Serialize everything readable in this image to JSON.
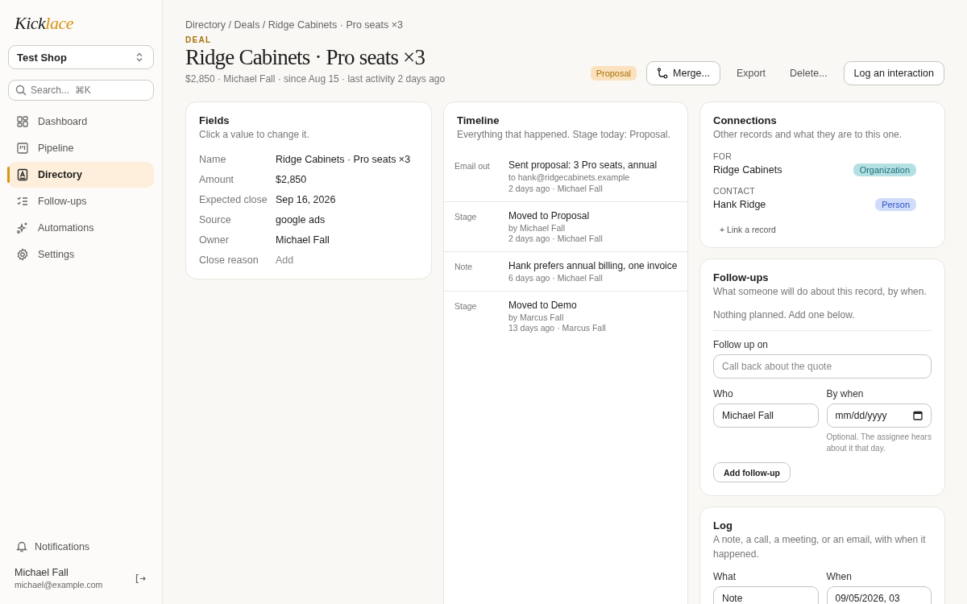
{
  "sidebar": {
    "logo": {
      "text": "Kick",
      "accent": "lace"
    },
    "workspace": "Test Shop",
    "search": {
      "placeholder": "Search...  ⌘K"
    },
    "items": [
      {
        "label": "Dashboard",
        "selected": false
      },
      {
        "label": "Pipeline",
        "selected": false
      },
      {
        "label": "Directory",
        "selected": true
      },
      {
        "label": "Follow-ups",
        "selected": false
      },
      {
        "label": "Automations",
        "selected": false
      },
      {
        "label": "Settings",
        "selected": false
      }
    ],
    "notifications": "Notifications",
    "user": {
      "name": "Michael Fall",
      "email": "michael@example.com"
    }
  },
  "breadcrumb": "Directory / Deals / Ridge Cabinets · Pro seats ×3",
  "eyebrow": "DEAL",
  "title": "Ridge Cabinets · Pro seats ×3",
  "meta": "$2,850 · Michael Fall · since Aug 15 · last activity 2 days ago",
  "actions": {
    "stage": "Proposal",
    "merge": "Merge...",
    "export": "Export",
    "delete": "Delete...",
    "primary": "Log an interaction"
  },
  "fields": {
    "title": "Fields",
    "subtitle": "Click a value to change it.",
    "rows": [
      {
        "label": "Name",
        "value": "Ridge Cabinets · Pro seats ×3",
        "empty": false
      },
      {
        "label": "Amount",
        "value": "$2,850",
        "empty": false
      },
      {
        "label": "Expected close",
        "value": "Sep 16, 2026",
        "empty": false
      },
      {
        "label": "Source",
        "value": "google ads",
        "empty": false
      },
      {
        "label": "Owner",
        "value": "Michael Fall",
        "empty": false
      },
      {
        "label": "Close reason",
        "value": "Add",
        "empty": true
      }
    ]
  },
  "timeline": {
    "title": "Timeline",
    "subtitle": "Everything that happened. Stage today: Proposal.",
    "entries": [
      {
        "kind": "Email out",
        "title": "Sent proposal: 3 Pro seats, annual",
        "details": [
          "to hank@ridgecabinets.example",
          "2 days ago · Michael Fall"
        ]
      },
      {
        "kind": "Stage",
        "title": "Moved to Proposal",
        "details": [
          "by Michael Fall",
          "2 days ago · Michael Fall"
        ]
      },
      {
        "kind": "Note",
        "title": "Hank prefers annual billing, one invoice",
        "details": [
          "6 days ago · Michael Fall"
        ]
      },
      {
        "kind": "Stage",
        "title": "Moved to Demo",
        "details": [
          "by Marcus Fall",
          "13 days ago · Marcus Fall"
        ]
      }
    ]
  },
  "connections": {
    "title": "Connections",
    "subtitle": "Other records and what they are to this one.",
    "groups": [
      {
        "heading": "FOR",
        "name": "Ridge Cabinets",
        "tag": "Organization",
        "color": "#b5e0e3"
      },
      {
        "heading": "CONTACT",
        "name": "Hank Ridge",
        "tag": "Person",
        "color": "#cfdcfb"
      }
    ],
    "link": "+ Link a record"
  },
  "follow_ups": {
    "title": "Follow-ups",
    "subtitle": "What someone will do about this record, by when.",
    "empty_note": "Nothing planned. Add one below.",
    "topic": {
      "label": "Follow up on",
      "placeholder": "Call back about the quote"
    },
    "who": {
      "label": "Who",
      "value": "Michael Fall"
    },
    "by_when": {
      "label": "By when",
      "placeholder": "mm/dd/yyyy",
      "hint": "Optional. The assignee hears about it that day."
    },
    "button": "Add follow-up"
  },
  "log": {
    "title": "Log",
    "subtitle": "A note, a call, a meeting, or an email, with when it happened.",
    "what": {
      "label": "What",
      "value": "Note"
    },
    "when": {
      "label": "When",
      "value": "09/05/2026, 03"
    }
  }
}
